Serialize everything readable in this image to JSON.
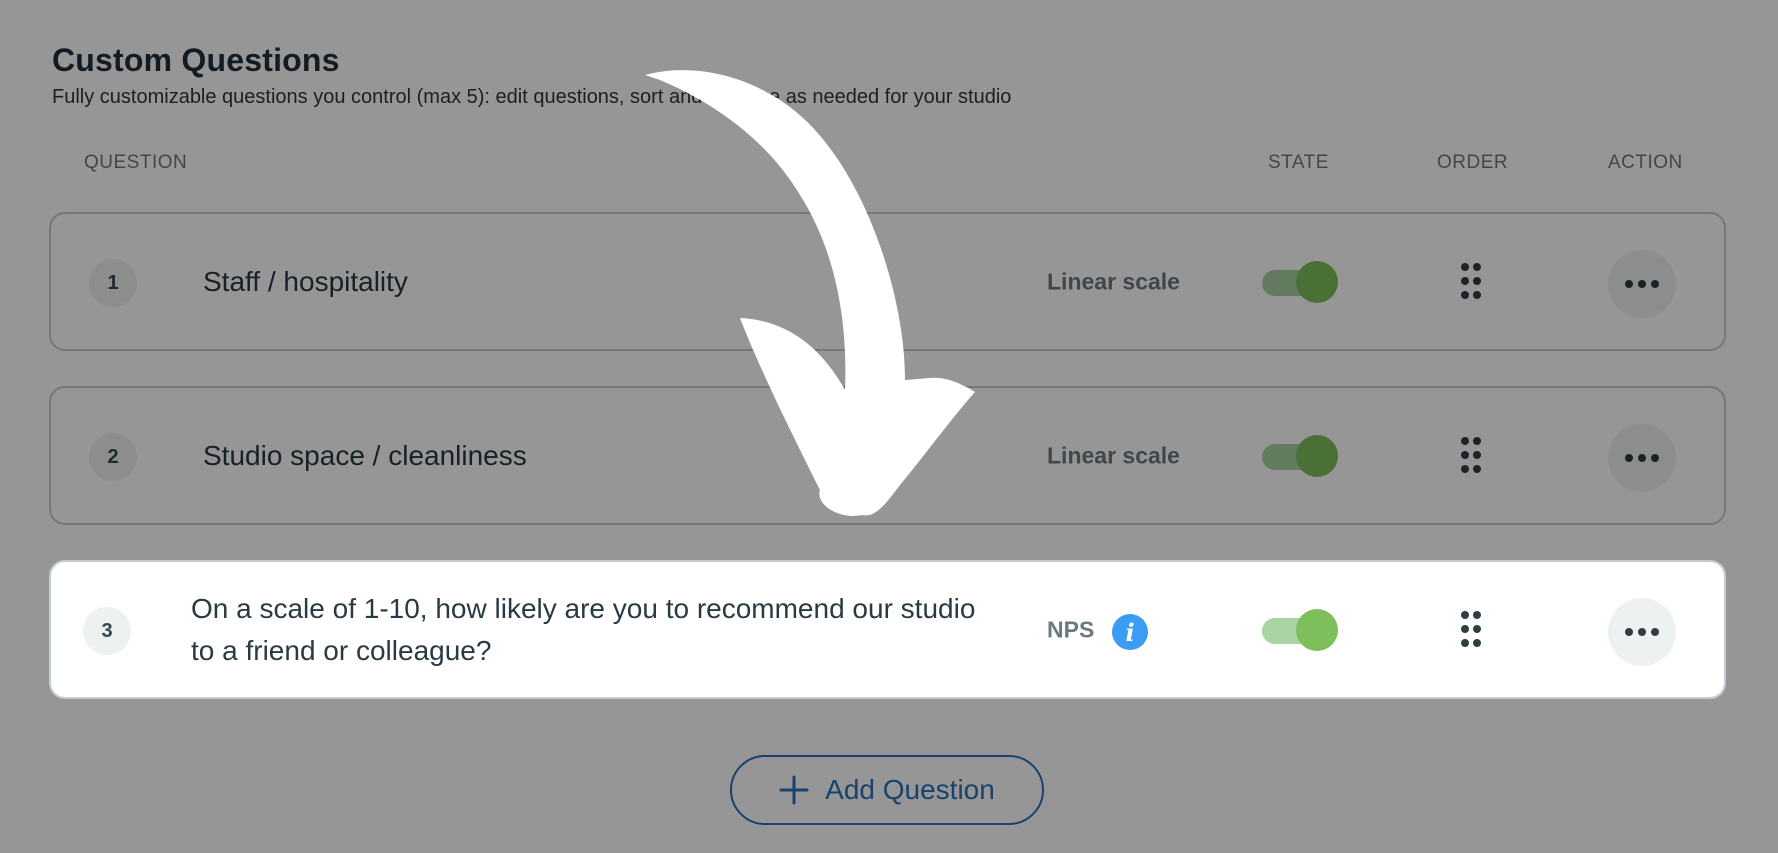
{
  "section": {
    "title": "Custom Questions",
    "subtitle": "Fully customizable questions you control (max 5): edit questions, sort and manage as needed for your studio"
  },
  "columns": {
    "question": "QUESTION",
    "state": "STATE",
    "order": "ORDER",
    "action": "ACTION"
  },
  "questions": [
    {
      "number": "1",
      "text": "Staff / hospitality",
      "type": "Linear scale",
      "enabled": true
    },
    {
      "number": "2",
      "text": "Studio space / cleanliness",
      "type": "Linear scale",
      "enabled": true
    },
    {
      "number": "3",
      "text": "On a scale of 1-10, how likely are you to recommend our studio to a friend or colleague?",
      "type": "NPS",
      "enabled": true,
      "info_icon": "info-icon"
    }
  ],
  "add_button": {
    "label": "Add Question",
    "icon": "plus-icon"
  },
  "colors": {
    "toggle_on_knob": "#7dbf5b",
    "toggle_on_track": "#a9d3a3",
    "info": "#3b9cf4",
    "primary": "#2b73b8"
  },
  "annotation": {
    "icon": "curved-arrow-icon",
    "color": "#ffffff"
  }
}
